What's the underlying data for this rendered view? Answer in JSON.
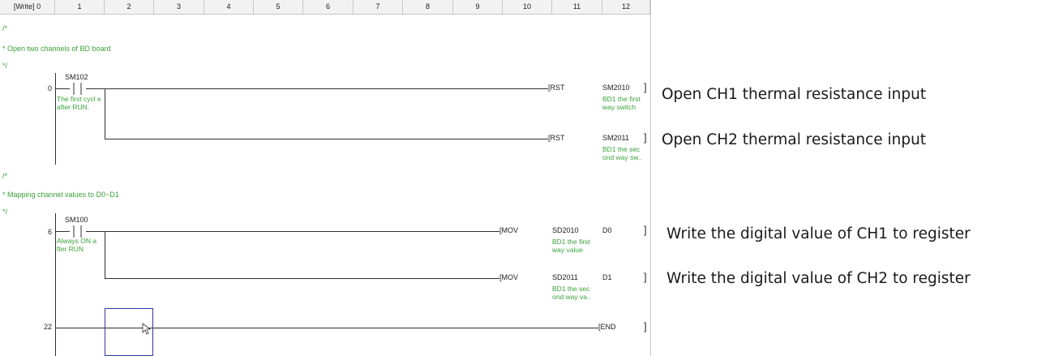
{
  "header": {
    "columns": [
      "[Write] 0",
      "1",
      "2",
      "3",
      "4",
      "5",
      "6",
      "7",
      "8",
      "9",
      "10",
      "11",
      "12"
    ]
  },
  "block1": {
    "comment_open": "/*",
    "comment_text": "* Open two channels of BD board",
    "comment_close": "*/",
    "step": "0",
    "contact": {
      "device": "SM102",
      "comment": "The first cycl e after RUN."
    },
    "rows": [
      {
        "instr": "[RST",
        "operand": "SM2010",
        "operand_comment": "BD1 the first way switch"
      },
      {
        "instr": "[RST",
        "operand": "SM2011",
        "operand_comment": "BD1 the sec ond way sw.."
      }
    ]
  },
  "block2": {
    "comment_open": "/*",
    "comment_text": "* Mapping channel values to D0~D1",
    "comment_close": "*/",
    "step": "6",
    "contact": {
      "device": "SM100",
      "comment": "Always ON a fter RUN"
    },
    "rows": [
      {
        "instr": "[MOV",
        "operand": "SD2010",
        "operand_comment": "BD1 the first way value",
        "dest": "D0"
      },
      {
        "instr": "[MOV",
        "operand": "SD2011",
        "operand_comment": "BD1 the sec ond way va..",
        "dest": "D1"
      }
    ]
  },
  "block3": {
    "step": "22",
    "instr": "[END"
  },
  "notes": [
    "Open CH1 thermal resistance input",
    "Open CH2 thermal resistance input",
    "Write the digital value of CH1 to register",
    "Write the digital value of CH2 to register"
  ],
  "colors": {
    "comment": "#3aa23a",
    "wire": "#303030",
    "cursor": "#2a3aa0"
  }
}
